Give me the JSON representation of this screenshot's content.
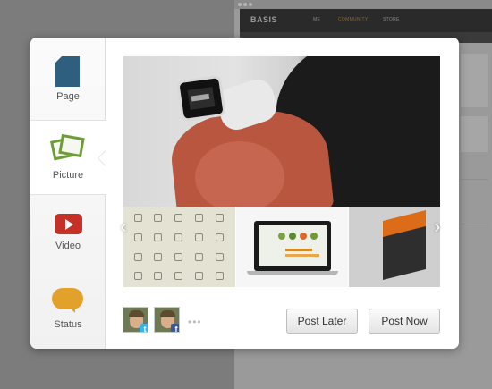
{
  "background_site": {
    "logo": "BASIS",
    "nav": [
      "ME",
      "COMMUNITY",
      "STORE"
    ]
  },
  "sidebar": {
    "items": [
      {
        "label": "Page",
        "icon": "page-icon",
        "color": "#2f5f7e",
        "active": false
      },
      {
        "label": "Picture",
        "icon": "pictures-icon",
        "color": "#6e9d36",
        "active": true
      },
      {
        "label": "Video",
        "icon": "video-play-icon",
        "color": "#c53127",
        "active": false
      },
      {
        "label": "Status",
        "icon": "speech-bubble-icon",
        "color": "#e2a12a",
        "active": false
      }
    ]
  },
  "gallery": {
    "prev": "‹",
    "next": "›"
  },
  "footer": {
    "accounts": [
      {
        "network": "twitter",
        "badge": "t",
        "color": "#38b5e8"
      },
      {
        "network": "facebook",
        "badge": "f",
        "color": "#3b5998"
      }
    ],
    "more": "•••",
    "post_later": "Post Later",
    "post_now": "Post Now"
  }
}
